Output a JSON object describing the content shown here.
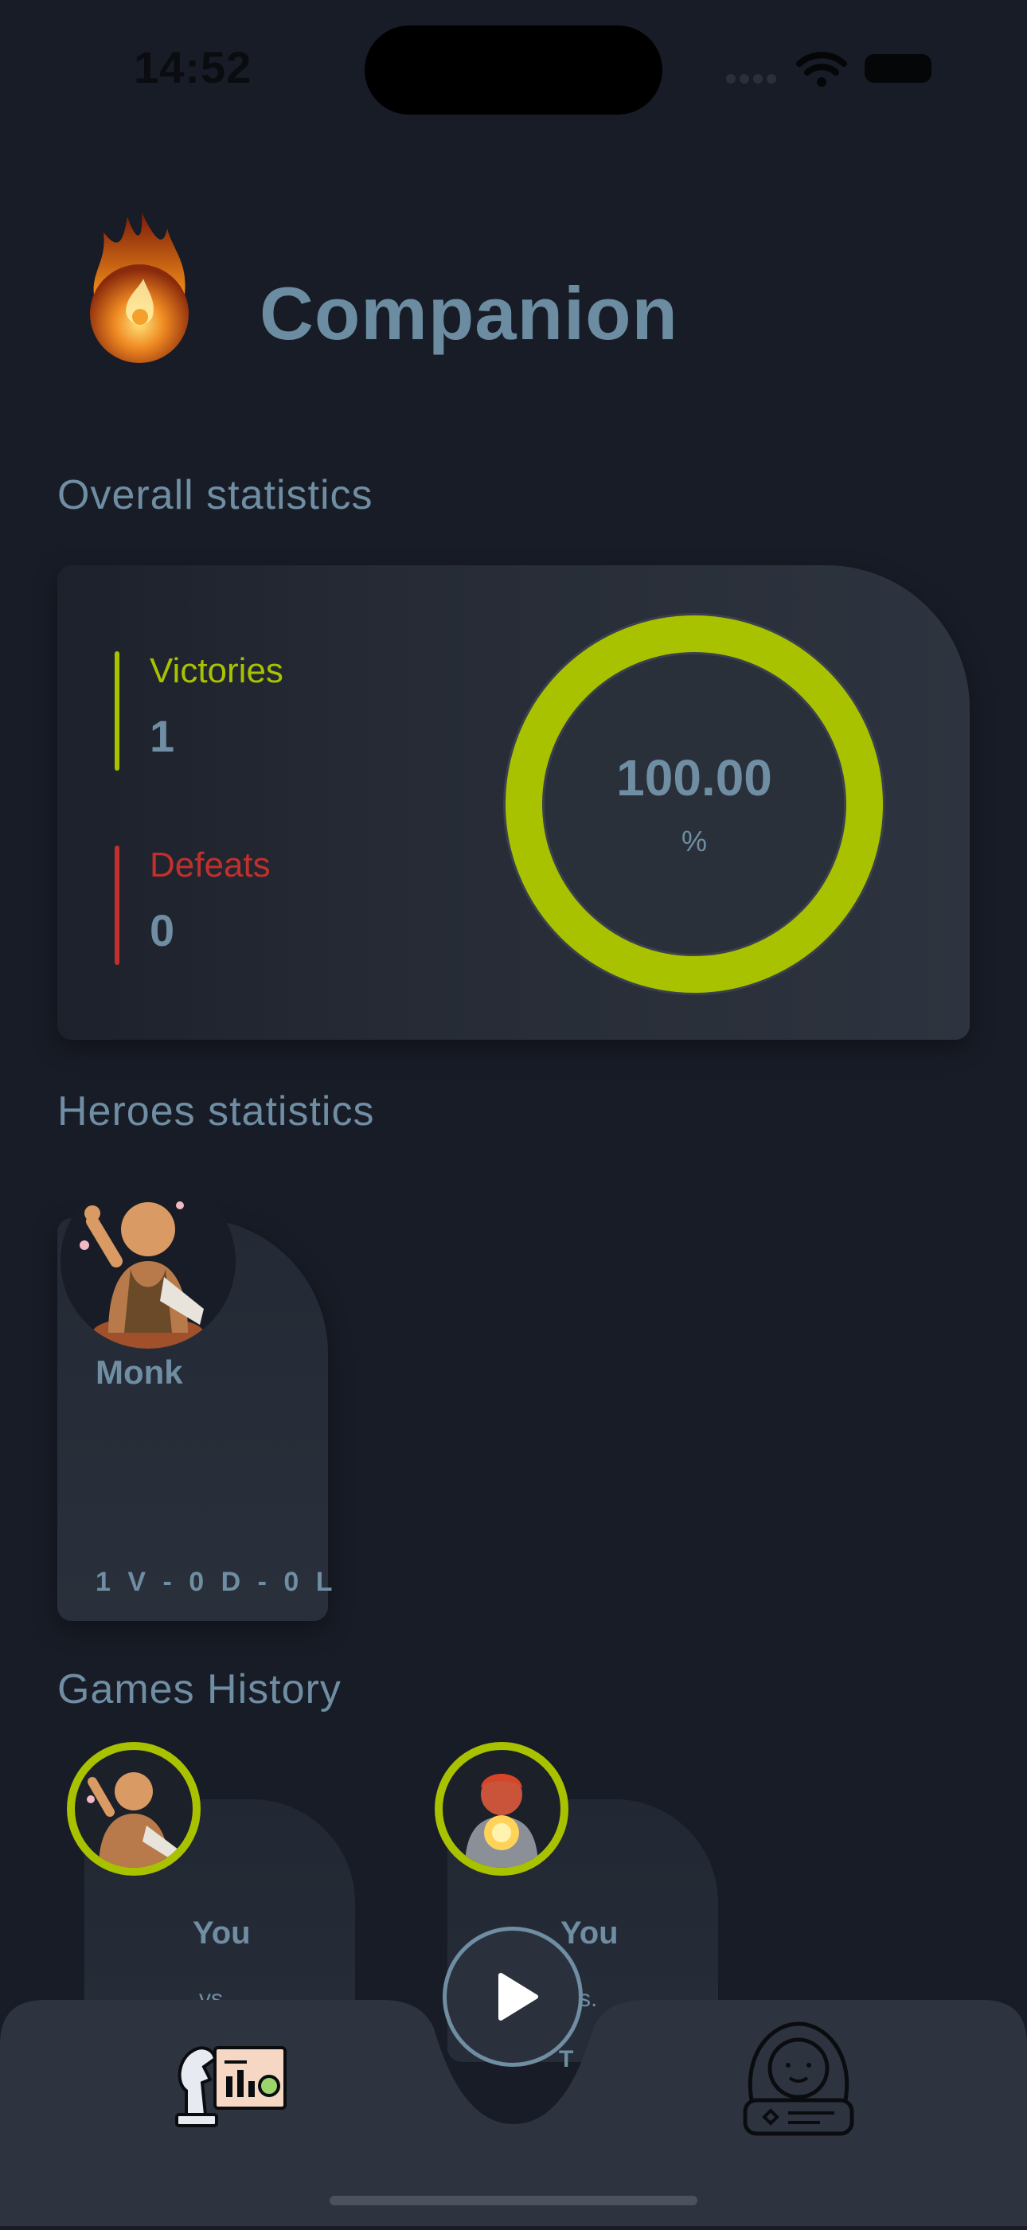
{
  "status_bar": {
    "time": "14:52"
  },
  "header": {
    "title": "Companion",
    "logo_icon": "flaming-orb-logo"
  },
  "overall": {
    "section_title": "Overall statistics",
    "victories_label": "Victories",
    "victories_value": "1",
    "defeats_label": "Defeats",
    "defeats_value": "0",
    "win_rate_value": "100.00",
    "win_rate_unit": "%",
    "win_rate_fraction": 1.0,
    "colors": {
      "victory": "#a9c200",
      "defeat": "#c0302c"
    }
  },
  "heroes": {
    "section_title": "Heroes statistics",
    "items": [
      {
        "name": "Monk",
        "record": "1 V - 0 D - 0 L",
        "avatar_icon": "monk-hero-portrait"
      }
    ]
  },
  "history": {
    "section_title": "Games History",
    "items": [
      {
        "player": "You",
        "vs": "vs.",
        "avatar_icon": "monk-hero-portrait"
      },
      {
        "player": "You",
        "vs": "vs.",
        "opponent_initial": "T",
        "avatar_icon": "fire-mage-hero-portrait"
      }
    ]
  },
  "tabbar": {
    "left_icon": "chess-knight-stats-icon",
    "center_icon": "play-icon",
    "right_icon": "astronaut-profile-icon"
  }
}
